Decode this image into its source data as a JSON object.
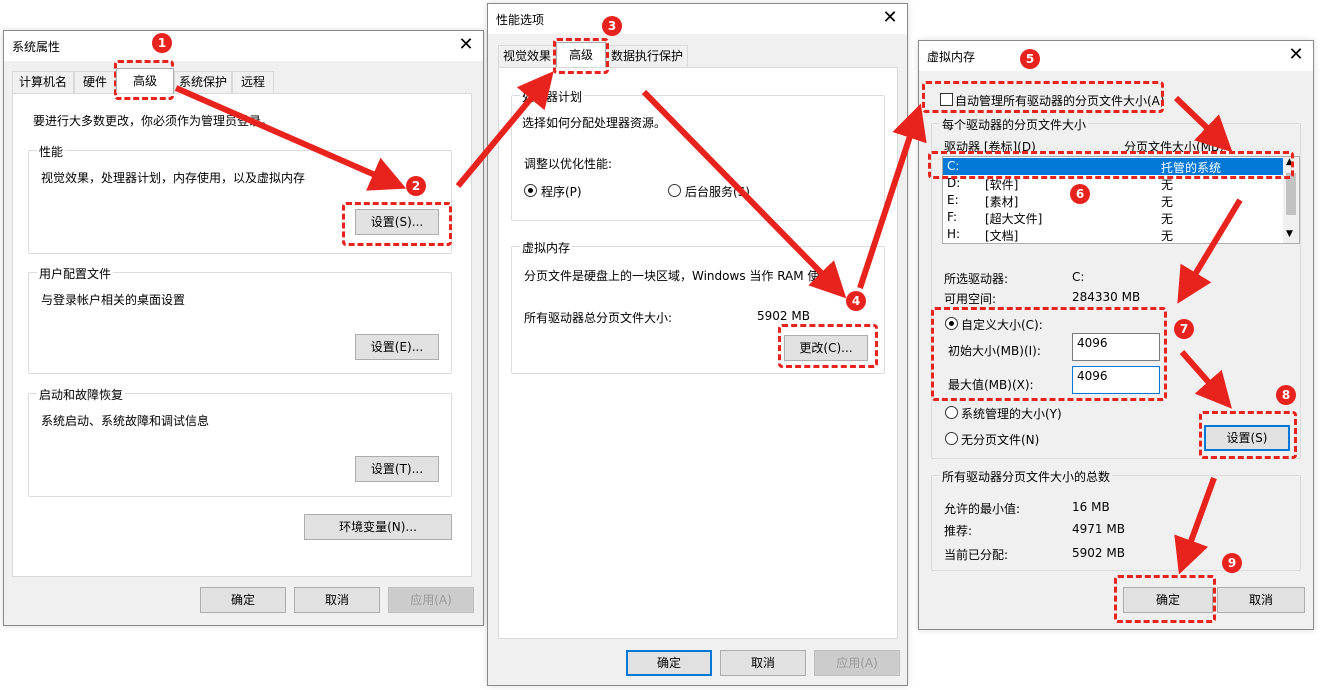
{
  "win1": {
    "title": "系统属性",
    "tabs": [
      "计算机名",
      "硬件",
      "高级",
      "系统保护",
      "远程"
    ],
    "admin_note": "要进行大多数更改，你必须作为管理员登录。",
    "perf_group": "性能",
    "perf_desc": "视觉效果，处理器计划，内存使用，以及虚拟内存",
    "perf_btn": "设置(S)...",
    "profile_group": "用户配置文件",
    "profile_desc": "与登录帐户相关的桌面设置",
    "profile_btn": "设置(E)...",
    "startup_group": "启动和故障恢复",
    "startup_desc": "系统启动、系统故障和调试信息",
    "startup_btn": "设置(T)...",
    "env_btn": "环境变量(N)...",
    "ok": "确定",
    "cancel": "取消",
    "apply": "应用(A)"
  },
  "win2": {
    "title": "性能选项",
    "tabs": [
      "视觉效果",
      "高级",
      "数据执行保护"
    ],
    "cpu_group": "处理器计划",
    "cpu_desc": "选择如何分配处理器资源。",
    "adjust_label": "调整以优化性能:",
    "radio_programs": "程序(P)",
    "radio_bg": "后台服务(S)",
    "vm_group": "虚拟内存",
    "vm_desc": "分页文件是硬盘上的一块区域，Windows 当作 RAM 使用。",
    "total_label": "所有驱动器总分页文件大小:",
    "total_value": "5902 MB",
    "change_btn": "更改(C)...",
    "ok": "确定",
    "cancel": "取消",
    "apply": "应用(A)"
  },
  "win3": {
    "title": "虚拟内存",
    "auto_manage": "自动管理所有驱动器的分页文件大小(A)",
    "per_drive_group": "每个驱动器的分页文件大小",
    "col_drive": "驱动器 [卷标](D)",
    "col_size": "分页文件大小(MB)",
    "drives": [
      {
        "drive": "C:",
        "label": "",
        "size": "托管的系统"
      },
      {
        "drive": "D:",
        "label": "[软件]",
        "size": "无"
      },
      {
        "drive": "E:",
        "label": "[素材]",
        "size": "无"
      },
      {
        "drive": "F:",
        "label": "[超大文件]",
        "size": "无"
      },
      {
        "drive": "H:",
        "label": "[文档]",
        "size": "无"
      }
    ],
    "selected_drive_label": "所选驱动器:",
    "selected_drive_value": "C:",
    "free_space_label": "可用空间:",
    "free_space_value": "284330 MB",
    "custom_size": "自定义大小(C):",
    "initial_label": "初始大小(MB)(I):",
    "initial_value": "4096",
    "max_label": "最大值(MB)(X):",
    "max_value": "4096",
    "system_managed": "系统管理的大小(Y)",
    "no_paging": "无分页文件(N)",
    "set_btn": "设置(S)",
    "totals_group": "所有驱动器分页文件大小的总数",
    "min_label": "允许的最小值:",
    "min_value": "16 MB",
    "rec_label": "推荐:",
    "rec_value": "4971 MB",
    "cur_label": "当前已分配:",
    "cur_value": "5902 MB",
    "ok": "确定",
    "cancel": "取消"
  },
  "annotations": {
    "steps": [
      "1",
      "2",
      "3",
      "4",
      "5",
      "6",
      "7",
      "8",
      "9"
    ],
    "color": "#e8231d"
  }
}
